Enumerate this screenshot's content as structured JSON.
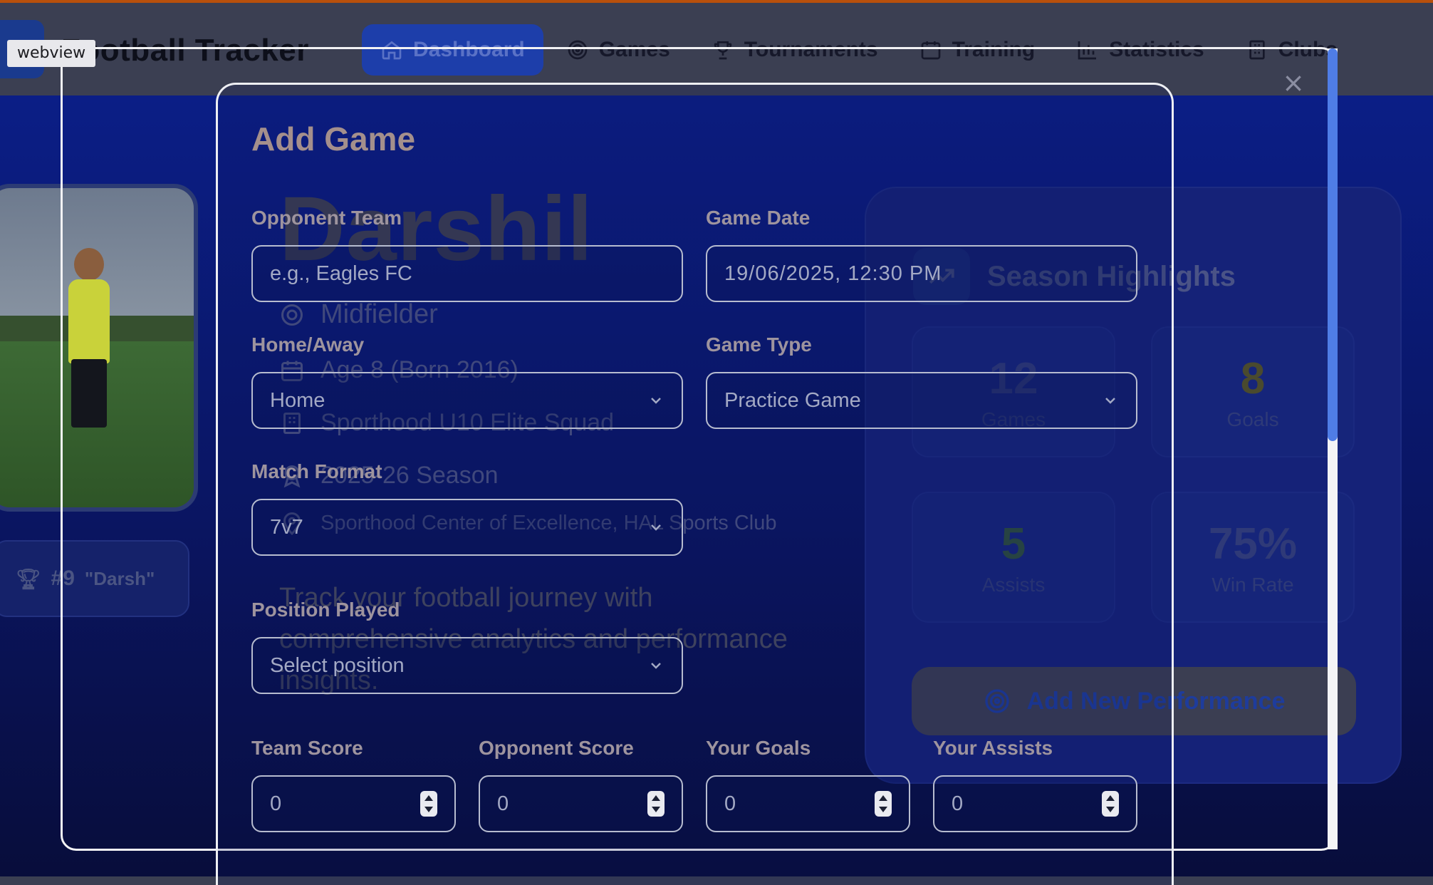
{
  "header": {
    "title": "Football Tracker",
    "nav": [
      {
        "label": "Dashboard",
        "icon": "home-icon",
        "active": true
      },
      {
        "label": "Games",
        "icon": "target-icon"
      },
      {
        "label": "Tournaments",
        "icon": "trophy-icon"
      },
      {
        "label": "Training",
        "icon": "calendar-icon"
      },
      {
        "label": "Statistics",
        "icon": "bar-chart-icon"
      },
      {
        "label": "Clubs",
        "icon": "building-icon"
      }
    ]
  },
  "profile": {
    "name": "Darshil",
    "position": "Midfielder",
    "age": "Age 8 (Born 2016)",
    "squad": "Sporthood U10 Elite Squad",
    "season": "2025-26 Season",
    "venue": "Sporthood Center of Excellence, HAL Sports Club",
    "tagline": "Track your football journey with comprehensive analytics and performance insights.",
    "number": "#9",
    "nickname": "\"Darsh\""
  },
  "highlights": {
    "title": "Season Highlights",
    "stats": [
      {
        "value": "12",
        "label": "Games"
      },
      {
        "value": "8",
        "label": "Goals"
      },
      {
        "value": "5",
        "label": "Assists"
      },
      {
        "value": "75%",
        "label": "Win Rate"
      }
    ],
    "add_button": "Add New Performance"
  },
  "overlay": {
    "webview_label": "webview",
    "close_symbol": "×",
    "scroll_fraction": 0.49
  },
  "modal": {
    "title": "Add Game",
    "opponent_team": {
      "label": "Opponent Team",
      "placeholder": "e.g., Eagles FC"
    },
    "game_date": {
      "label": "Game Date",
      "value": "19/06/2025, 12:30 PM"
    },
    "home_away": {
      "label": "Home/Away",
      "value": "Home"
    },
    "game_type": {
      "label": "Game Type",
      "value": "Practice Game"
    },
    "match_format": {
      "label": "Match Format",
      "value": "7v7"
    },
    "position_played": {
      "label": "Position Played",
      "value": "Select position"
    },
    "team_score": {
      "label": "Team Score",
      "value": "0"
    },
    "opponent_score": {
      "label": "Opponent Score",
      "value": "0"
    },
    "your_goals": {
      "label": "Your Goals",
      "value": "0"
    },
    "your_assists": {
      "label": "Your Assists",
      "value": "0"
    }
  },
  "colors": {
    "accent": "#4f7de6",
    "page_background": "#0b1e86",
    "goals_value": "#b8860b",
    "assists_value": "#3a7a3a"
  }
}
